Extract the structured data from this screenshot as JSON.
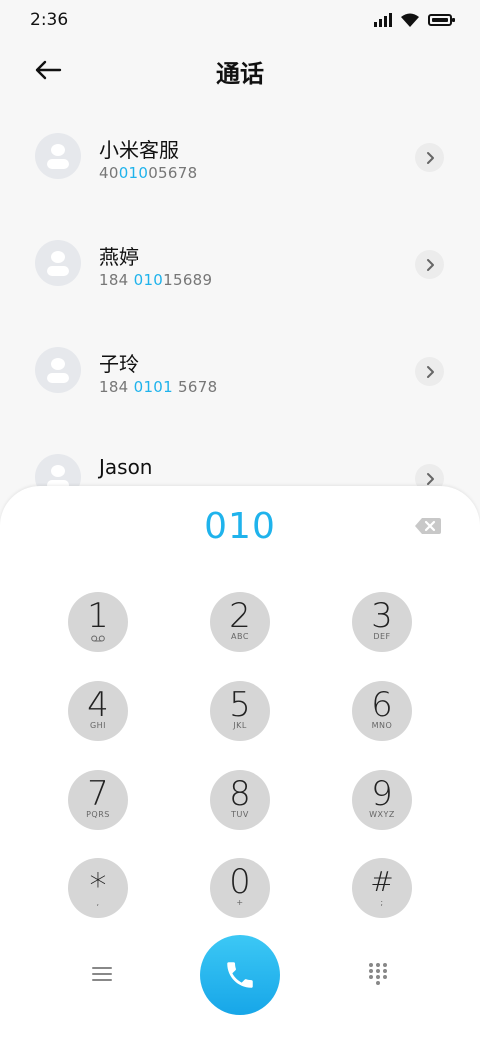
{
  "status": {
    "time": "2:36"
  },
  "header": {
    "title": "通话"
  },
  "contacts": [
    {
      "name": "小米客服",
      "number_pre": "40",
      "number_match": "010",
      "number_post": "05678"
    },
    {
      "name": "燕婷",
      "number_pre": "184 ",
      "number_match": "010",
      "number_post": "15689"
    },
    {
      "name": "子玲",
      "number_pre": "184 ",
      "number_match": "0101",
      "number_post": " 5678"
    },
    {
      "name": "Jason",
      "number_pre": "",
      "number_match": "",
      "number_post": ""
    }
  ],
  "dialpad": {
    "display": "010",
    "keys": [
      {
        "digit": "1",
        "letters": ""
      },
      {
        "digit": "2",
        "letters": "ABC"
      },
      {
        "digit": "3",
        "letters": "DEF"
      },
      {
        "digit": "4",
        "letters": "GHI"
      },
      {
        "digit": "5",
        "letters": "JKL"
      },
      {
        "digit": "6",
        "letters": "MNO"
      },
      {
        "digit": "7",
        "letters": "PQRS"
      },
      {
        "digit": "8",
        "letters": "TUV"
      },
      {
        "digit": "9",
        "letters": "WXYZ"
      },
      {
        "digit": "*",
        "letters": ","
      },
      {
        "digit": "0",
        "letters": "+"
      },
      {
        "digit": "#",
        "letters": ";"
      }
    ]
  },
  "icons": {
    "back": "arrow-left-icon",
    "chevron": "chevron-right-icon",
    "backspace": "backspace-icon",
    "voicemail": "voicemail-icon",
    "menu": "menu-icon",
    "call": "phone-icon",
    "dialpad": "dialpad-icon"
  },
  "colors": {
    "accent": "#1fb3ec",
    "key_bg": "#d6d6d6",
    "avatar_bg": "#e6e8ec"
  }
}
